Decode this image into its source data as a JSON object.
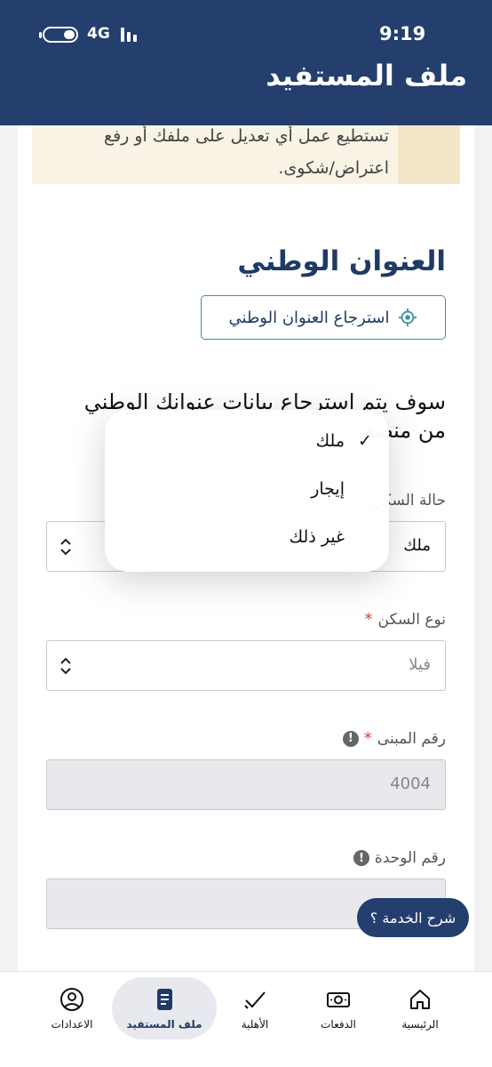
{
  "status": {
    "time": "9:19",
    "network": "4G"
  },
  "header": {
    "title": "ملف المستفيد"
  },
  "notice": {
    "text": "تستطيع عمل أي تعديل على ملفك أو رفع اعتراض/شكوى."
  },
  "national_address": {
    "title": "العنوان الوطني",
    "fetch_button": "استرجاع العنوان الوطني",
    "description": "سوف يتم استرجاع بيانات عنوانك الوطني من منصة"
  },
  "fields": {
    "housing_status": {
      "label": "حالة السكن",
      "value": "ملك"
    },
    "housing_type": {
      "label": "نوع السكن",
      "required": "*",
      "value": "فيلا"
    },
    "building_number": {
      "label": "رقم المبنى",
      "required": "*",
      "value": "4004"
    },
    "unit_number": {
      "label": "رقم الوحدة",
      "value": ""
    }
  },
  "dropdown": {
    "check": "✓",
    "options": [
      "ملك",
      "إيجار",
      "غير ذلك"
    ]
  },
  "help_button": "شرح الخدمة ؟",
  "nav": {
    "home": "الرئيسية",
    "payments": "الدفعات",
    "eligibility": "الأهلية",
    "profile": "ملف المستفيد",
    "settings": "الاعدادات"
  },
  "colors": {
    "primary": "#243e6e",
    "accent": "#3e8fa8",
    "required": "#d0473a"
  }
}
